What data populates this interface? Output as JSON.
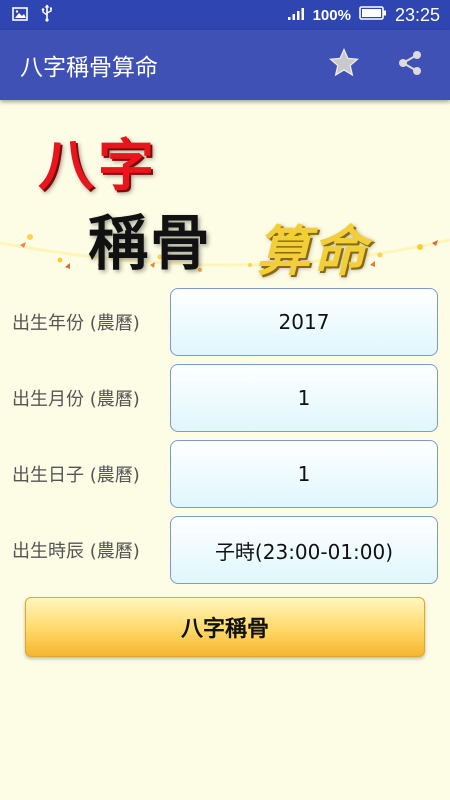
{
  "status_bar": {
    "battery": "100%",
    "time": "23:25",
    "icons": [
      "image-icon",
      "usb-icon",
      "signal-icon",
      "battery-icon"
    ]
  },
  "app_bar": {
    "title": "八字稱骨算命",
    "actions": [
      "star-icon",
      "share-icon"
    ],
    "color": "#3f51b5"
  },
  "banner": {
    "line1": "八字",
    "line2": "稱骨",
    "line3": "算命"
  },
  "form": {
    "rows": [
      {
        "label": "出生年份 (農曆)",
        "value": "2017"
      },
      {
        "label": "出生月份 (農曆)",
        "value": "1"
      },
      {
        "label": "出生日子 (農曆)",
        "value": "1"
      },
      {
        "label": "出生時辰 (農曆)",
        "value": "子時(23:00-01:00)"
      }
    ]
  },
  "submit_button": {
    "label": "八字稱骨"
  }
}
